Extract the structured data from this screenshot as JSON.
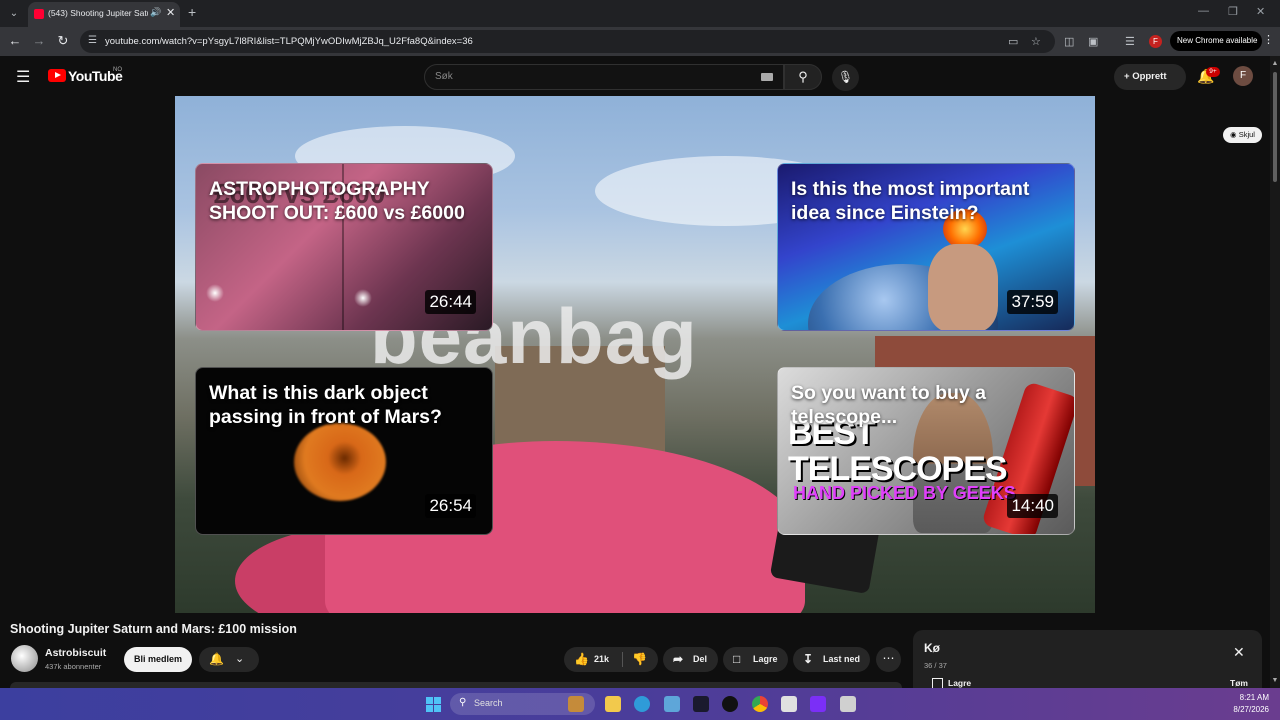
{
  "browser": {
    "tab_title": "(543) Shooting Jupiter Satu",
    "url": "youtube.com/watch?v=pYsgyL7l8RI&list=TLPQMjYwODIwMjZBJq_U2Ffa8Q&index=36",
    "profile_initial": "F",
    "new_chrome_label": "New Chrome available"
  },
  "yt": {
    "wordmark": "YouTube",
    "region": "NO",
    "search_placeholder": "Søk",
    "create_label": "Opprett",
    "notif_count": "9+",
    "avatar_initial": "F"
  },
  "player": {
    "overlay_word": "beanbag",
    "skip_label": "Skjul",
    "endcards": [
      {
        "title": "ASTROPHOTOGRAPHY SHOOT OUT: £600 vs £6000",
        "ghost": "£600 vs £600",
        "duration": "26:44"
      },
      {
        "title": "Is this the most important idea since Einstein?",
        "duration": "37:59"
      },
      {
        "title": "What is this dark object passing in front of Mars?",
        "duration": "26:54"
      },
      {
        "title": "So you want to buy a telescope...",
        "big_line1": "BEST",
        "big_line2": "TELESCOPES",
        "pink_line": "HAND PICKED BY GEEKS",
        "duration": "14:40"
      }
    ]
  },
  "video": {
    "title": "Shooting Jupiter Saturn and Mars: £100 mission",
    "channel": "Astrobiscuit",
    "subscribers": "437k abonnenter",
    "join_label": "Bli medlem",
    "likes": "21k",
    "share_label": "Del",
    "save_label": "Lagre",
    "download_label": "Last ned"
  },
  "queue": {
    "title": "Kø",
    "count": "36 / 37",
    "save_label": "Lagre",
    "clear_label": "Tøm"
  },
  "taskbar": {
    "search_label": "Search",
    "time": "8:21 AM",
    "date": "8/27/2026"
  },
  "colors": {
    "yt_red": "#ff0000",
    "bg": "#0f0f0f",
    "taskbar": "#3c3f9f"
  }
}
